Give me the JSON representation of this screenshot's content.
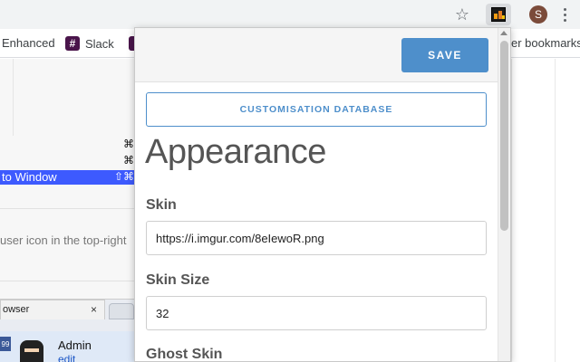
{
  "browser": {
    "avatar_letter": "S",
    "icons": {
      "star": "star-icon",
      "extension": "extension-icon",
      "menu": "kebab-menu-icon"
    }
  },
  "bookmarks": {
    "items": [
      {
        "label": "Enhanced"
      },
      {
        "label": "Slack",
        "icon": "slack-icon"
      }
    ],
    "other_label": "er bookmarks"
  },
  "background": {
    "menu_rows": [
      {
        "label": "",
        "shortcut": "⌘"
      },
      {
        "label": "",
        "shortcut": "⌘"
      },
      {
        "label": "to Window",
        "shortcut": "⇧⌘"
      }
    ],
    "help_text": "user icon in the top-right",
    "tab_label": "owser",
    "tab_close": "×",
    "badge_text": "99",
    "admin_name": "Admin",
    "admin_link": "edit"
  },
  "popup": {
    "save_label": "SAVE",
    "custom_db_label": "CUSTOMISATION DATABASE",
    "section_title": "Appearance",
    "fields": [
      {
        "label": "Skin",
        "value": "https://i.imgur.com/8eIewoR.png"
      },
      {
        "label": "Skin Size",
        "value": "32"
      },
      {
        "label": "Ghost Skin",
        "value": ""
      }
    ]
  },
  "colors": {
    "accent": "#4e8fcb",
    "selected_row": "#3d5afe",
    "slack": "#4a154b"
  }
}
